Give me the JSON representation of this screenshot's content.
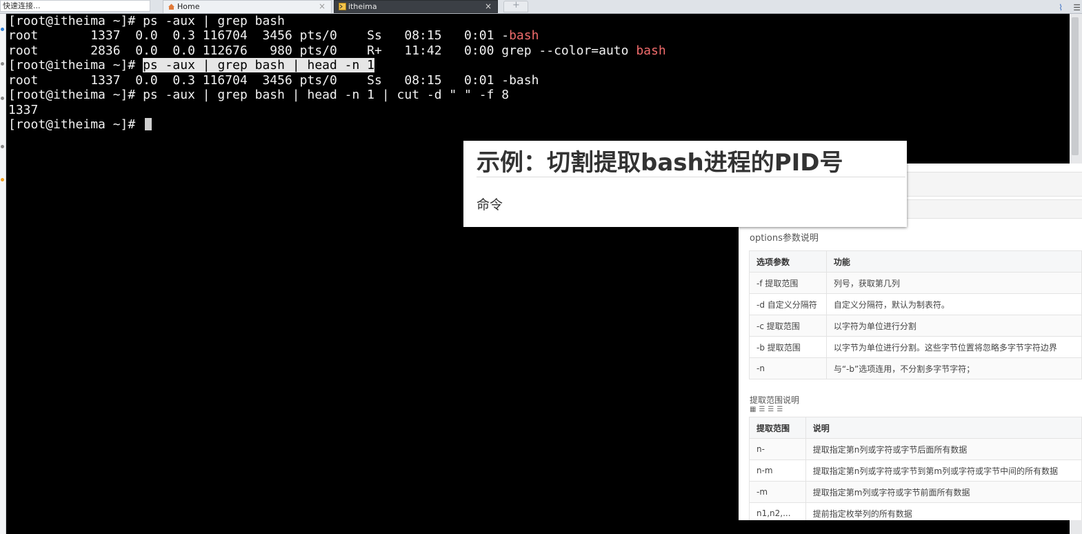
{
  "tabbar": {
    "quick_connect": "快速连接...",
    "tabs": [
      {
        "label": "Home",
        "close": "×"
      },
      {
        "label": "itheima",
        "close": "×"
      }
    ],
    "new_tab": "+"
  },
  "terminal": {
    "lines": [
      {
        "parts": [
          "[root@itheima ~]# ps -aux | grep bash"
        ]
      },
      {
        "parts": [
          "root       1337  0.0  0.3 116704  3456 pts/0    Ss   08:15   0:01 -",
          "bash"
        ]
      },
      {
        "parts": [
          "root       2836  0.0  0.0 112676   980 pts/0    R+   11:42   0:00 grep --color=auto ",
          "bash"
        ]
      },
      {
        "parts": [
          "[root@itheima ~]# ",
          "ps -aux | grep bash | head -n 1"
        ]
      },
      {
        "parts": [
          "root       1337  0.0  0.3 116704  3456 pts/0    Ss   08:15   0:01 -bash"
        ]
      },
      {
        "parts": [
          "[root@itheima ~]# ps -aux | grep bash | head -n 1 | cut -d \" \" -f 8"
        ]
      },
      {
        "parts": [
          "1337"
        ]
      },
      {
        "parts": [
          "[root@itheima ~]# "
        ]
      }
    ],
    "colors": {
      "match": "#ef6b6b",
      "text": "#f2f2f2"
    }
  },
  "slide": {
    "title": "示例：切割提取bash进程的PID号",
    "subtitle": "命令"
  },
  "doc": {
    "options_heading": "options参数说明",
    "options_table": {
      "headers": [
        "选项参数",
        "功能"
      ],
      "rows": [
        [
          "-f 提取范围",
          "列号，获取第几列"
        ],
        [
          "-d 自定义分隔符",
          "自定义分隔符，默认为制表符。"
        ],
        [
          "-c 提取范围",
          "以字符为单位进行分割"
        ],
        [
          "-b 提取范围",
          "以字节为单位进行分割。这些字节位置将忽略多字节字符边界"
        ],
        [
          "-n",
          "与“-b”选项连用，不分割多字节字符；"
        ]
      ]
    },
    "range_heading": "提取范围说明",
    "range_table": {
      "headers": [
        "提取范围",
        "说明"
      ],
      "rows": [
        [
          "n-",
          "提取指定第n列或字符或字节后面所有数据"
        ],
        [
          "n-m",
          "提取指定第n列或字符或字节到第m列或字符或字节中间的所有数据"
        ],
        [
          "-m",
          "提取指定第m列或字符或字节前面所有数据"
        ],
        [
          "n1,n2,...",
          "提前指定枚举列的所有数据"
        ]
      ]
    }
  }
}
